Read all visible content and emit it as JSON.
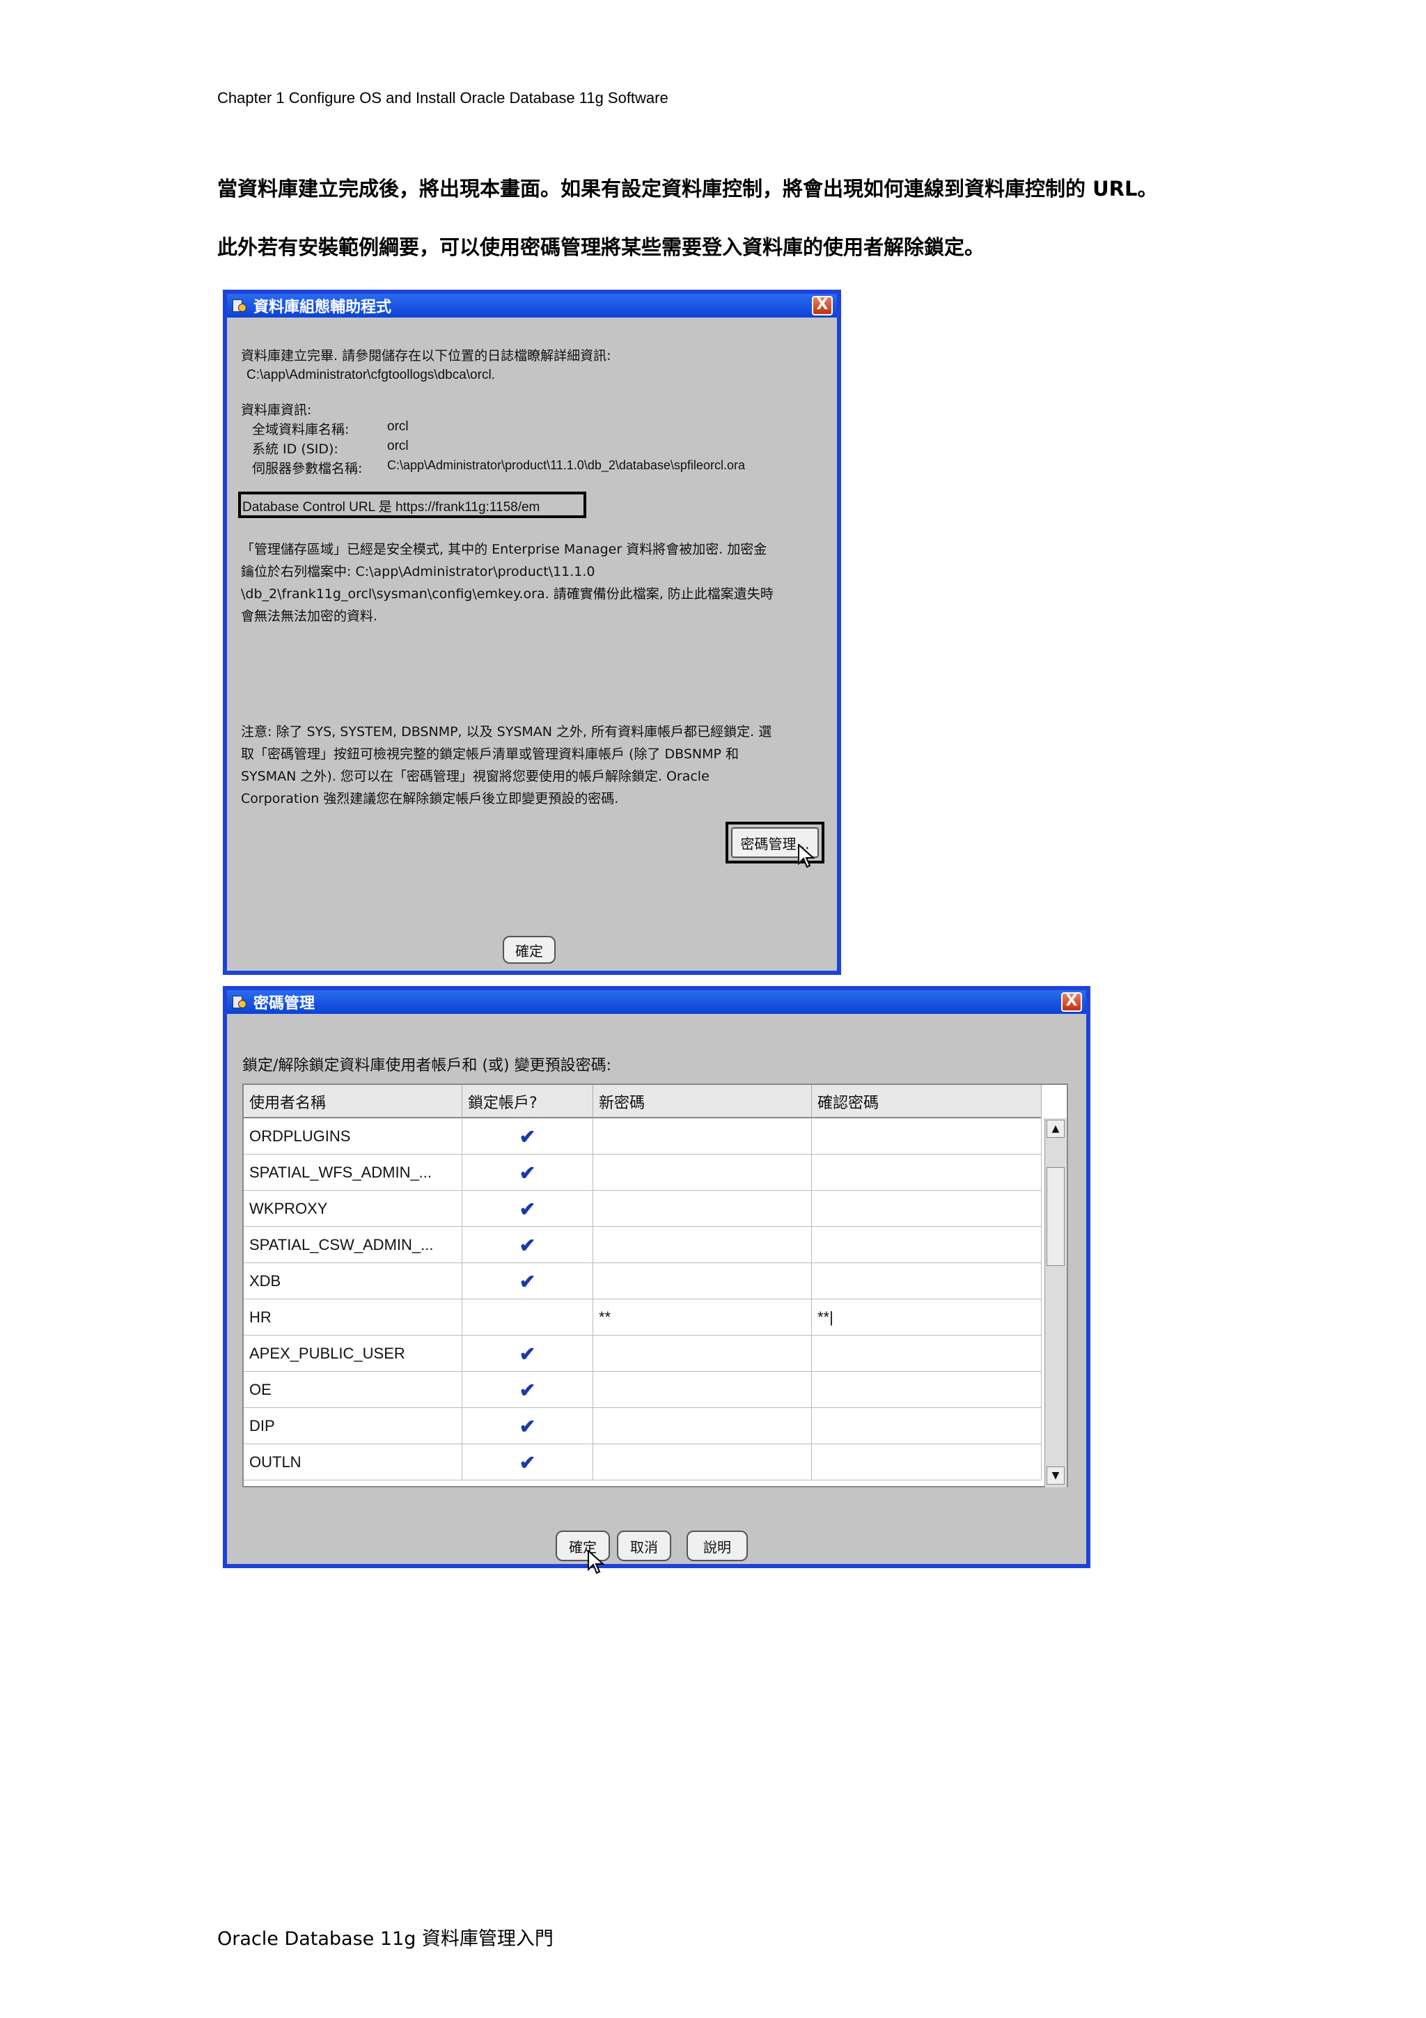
{
  "header": {
    "chapter": "Chapter 1 Configure OS and Install Oracle Database 11g Software"
  },
  "paragraphs": [
    "當資料庫建立完成後，將出現本畫面。如果有設定資料庫控制，將會出現如何連線到資料庫控制的 URL。",
    "此外若有安裝範例綱要，可以使用密碼管理將某些需要登入資料庫的使用者解除鎖定。"
  ],
  "dbca": {
    "title": "資料庫組態輔助程式",
    "close": "X",
    "complete_msg": "資料庫建立完畢. 請參閱儲存在以下位置的日誌檔瞭解詳細資訊:",
    "log_path": "C:\\app\\Administrator\\cfgtoollogs\\dbca\\orcl.",
    "info_heading": "資料庫資訊:",
    "info": [
      {
        "key": "全域資料庫名稱:",
        "value": "orcl"
      },
      {
        "key": "系統 ID (SID):",
        "value": "orcl"
      },
      {
        "key": "伺服器參數檔名稱:",
        "value": "C:\\app\\Administrator\\product\\11.1.0\\db_2\\database\\spfileorcl.ora"
      }
    ],
    "dbcontrol_url": "Database Control URL 是 https://frank11g:1158/em",
    "encryption": [
      "「管理儲存區域」已經是安全模式, 其中的 Enterprise Manager 資料將會被加密.  加密金",
      "鑰位於右列檔案中: C:\\app\\Administrator\\product\\11.1.0",
      "\\db_2\\frank11g_orcl\\sysman\\config\\emkey.ora.   請確實備份此檔案, 防止此檔案遺失時",
      "會無法無法加密的資料."
    ],
    "note": [
      "注意: 除了 SYS, SYSTEM, DBSNMP, 以及 SYSMAN 之外, 所有資料庫帳戶都已經鎖定. 選",
      "取「密碼管理」按鈕可檢視完整的鎖定帳戶清單或管理資料庫帳戶 (除了 DBSNMP 和",
      "SYSMAN 之外). 您可以在「密碼管理」視窗將您要使用的帳戶解除鎖定. Oracle",
      "Corporation 強烈建議您在解除鎖定帳戶後立即變更預設的密碼."
    ],
    "password_button": "密碼管理...",
    "ok_button": "確定"
  },
  "pwd": {
    "title": "密碼管理",
    "close": "X",
    "instruction": "鎖定/解除鎖定資料庫使用者帳戶和 (或) 變更預設密碼:",
    "columns": [
      "使用者名稱",
      "鎖定帳戶?",
      "新密碼",
      "確認密碼"
    ],
    "rows": [
      {
        "user": "ORDPLUGINS",
        "locked": "✔",
        "new": "",
        "confirm": ""
      },
      {
        "user": "SPATIAL_WFS_ADMIN_...",
        "locked": "✔",
        "new": "",
        "confirm": ""
      },
      {
        "user": "WKPROXY",
        "locked": "✔",
        "new": "",
        "confirm": ""
      },
      {
        "user": "SPATIAL_CSW_ADMIN_...",
        "locked": "✔",
        "new": "",
        "confirm": ""
      },
      {
        "user": "XDB",
        "locked": "✔",
        "new": "",
        "confirm": ""
      },
      {
        "user": "HR",
        "locked": "",
        "new": "**",
        "confirm": "**|"
      },
      {
        "user": "APEX_PUBLIC_USER",
        "locked": "✔",
        "new": "",
        "confirm": ""
      },
      {
        "user": "OE",
        "locked": "✔",
        "new": "",
        "confirm": ""
      },
      {
        "user": "DIP",
        "locked": "✔",
        "new": "",
        "confirm": ""
      },
      {
        "user": "OUTLN",
        "locked": "✔",
        "new": "",
        "confirm": ""
      }
    ],
    "ok_button": "確定",
    "cancel_button": "取消",
    "help_button": "說明"
  },
  "footer": {
    "text": "Oracle Database 11g 資料庫管理入門"
  }
}
